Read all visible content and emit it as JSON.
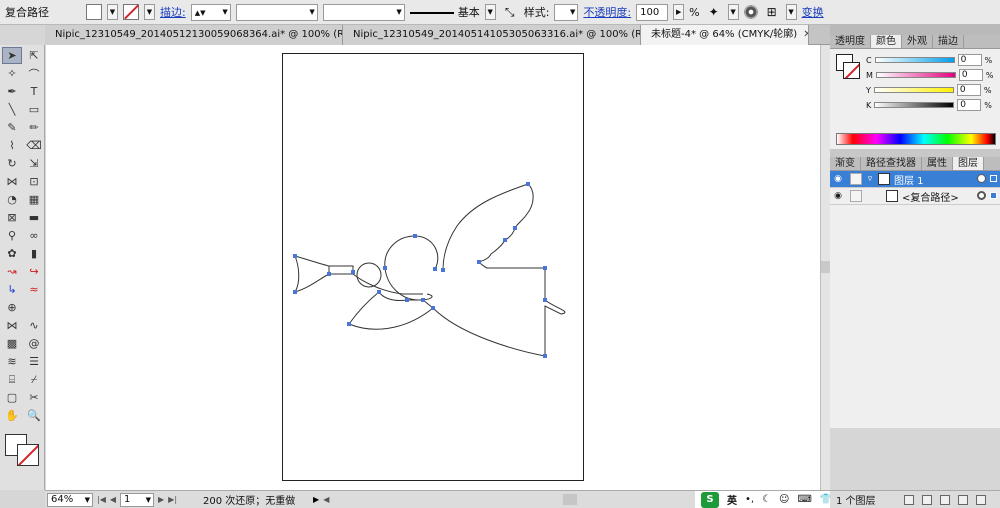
{
  "control_bar": {
    "selection_label": "复合路径",
    "stroke_label": "描边:",
    "brush_name": "基本",
    "style_label": "样式:",
    "opacity_label": "不透明度:",
    "opacity_value": "100",
    "opacity_unit": "%",
    "transform_label": "变换"
  },
  "tabs": [
    {
      "label": "Nipic_12310549_20140512130059068364.ai* @ 100% (R..."
    },
    {
      "label": "Nipic_12310549_20140514105305063316.ai* @ 100% (R..."
    },
    {
      "label": "未标题-4* @ 64% (CMYK/轮廓)"
    }
  ],
  "status_bar": {
    "zoom": "64%",
    "artboard_num": "1",
    "status_text": "200 次还原；无重做",
    "ime_label": "英"
  },
  "color_panel": {
    "tabs": [
      "透明度",
      "颜色",
      "外观",
      "描边"
    ],
    "channels": [
      {
        "name": "C",
        "value": "0"
      },
      {
        "name": "M",
        "value": "0"
      },
      {
        "name": "Y",
        "value": "0"
      },
      {
        "name": "K",
        "value": "0"
      }
    ],
    "colors": {
      "c": "#00a0e9",
      "m": "#e4007f",
      "y": "#fff100",
      "k": "#000000"
    }
  },
  "layers_panel": {
    "tabs": [
      "渐变",
      "路径查找器",
      "属性",
      "图层"
    ],
    "layer_name": "图层 1",
    "sublayer_name": "<复合路径>",
    "footer_count": "1 个图层"
  }
}
